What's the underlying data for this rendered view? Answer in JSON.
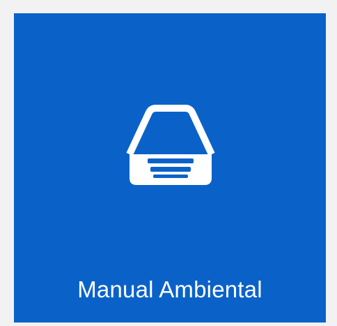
{
  "tile": {
    "label": "Manual Ambiental",
    "icon": "inbox-tray-icon",
    "background_color": "#0a62c9",
    "text_color": "#ffffff"
  }
}
